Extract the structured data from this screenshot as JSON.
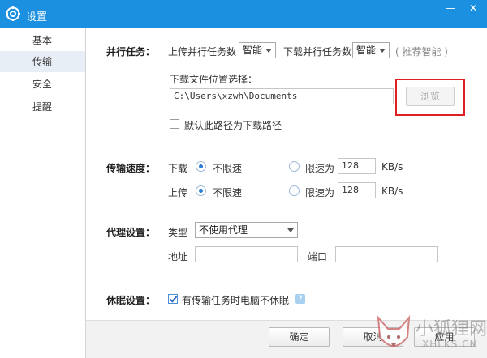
{
  "window": {
    "title": "设置",
    "minimize": "—",
    "close": "✕",
    "accent_color": "#1b8fe0"
  },
  "sidebar": {
    "items": [
      {
        "label": "基本",
        "active": false
      },
      {
        "label": "传输",
        "active": true
      },
      {
        "label": "安全",
        "active": false
      },
      {
        "label": "提醒",
        "active": false
      }
    ]
  },
  "parallel": {
    "section_label": "并行任务：",
    "upload_label": "上传并行任务数",
    "upload_value": "智能",
    "download_label": "下载并行任务数",
    "download_value": "智能",
    "hint": "( 推荐智能 )"
  },
  "download_location": {
    "label": "下载文件位置选择：",
    "path": "C:\\Users\\xzwh\\Documents",
    "browse_label": "浏览",
    "default_checkbox_label": "默认此路径为下载路径",
    "default_checked": false
  },
  "speed": {
    "section_label": "传输速度：",
    "download_label": "下载",
    "upload_label": "上传",
    "unlimited_label": "不限速",
    "limit_label": "限速为",
    "unit": "KB/s",
    "download_limit_value": "128",
    "upload_limit_value": "128",
    "download_mode": "unlimited",
    "upload_mode": "unlimited"
  },
  "proxy": {
    "section_label": "代理设置：",
    "type_label": "类型",
    "type_value": "不使用代理",
    "address_label": "地址",
    "address_value": "",
    "port_label": "端口",
    "port_value": ""
  },
  "sleep": {
    "section_label": "休眠设置：",
    "checkbox_label": "有传输任务时电脑不休眠",
    "checked": true,
    "help": "?"
  },
  "footer": {
    "ok_label": "确定",
    "cancel_label": "取消",
    "apply_label": "应用"
  },
  "watermark": {
    "text_cn": "小狐狸网",
    "text_en": "XHLKS.CN"
  }
}
